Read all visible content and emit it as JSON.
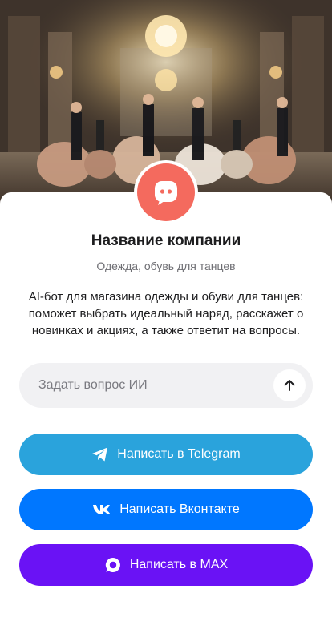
{
  "company": {
    "name": "Название компании",
    "category": "Одежда, обувь для танцев",
    "description": "AI-бот для магазина одежды и обуви для танцев: поможет выбрать идеальный наряд, расскажет о новинках и акциях, а также ответит на вопросы."
  },
  "ask": {
    "placeholder": "Задать вопрос ИИ"
  },
  "buttons": {
    "telegram": "Написать в Telegram",
    "vk": "Написать Вконтакте",
    "max": "Написать в MAX"
  },
  "colors": {
    "avatar": "#f46a5e",
    "telegram": "#2aa3dc",
    "vk": "#0077ff",
    "max": "#6a12f5"
  },
  "icons": {
    "avatar": "chat-bot-icon",
    "send": "arrow-up-icon",
    "telegram": "telegram-icon",
    "vk": "vk-icon",
    "max": "max-icon"
  }
}
